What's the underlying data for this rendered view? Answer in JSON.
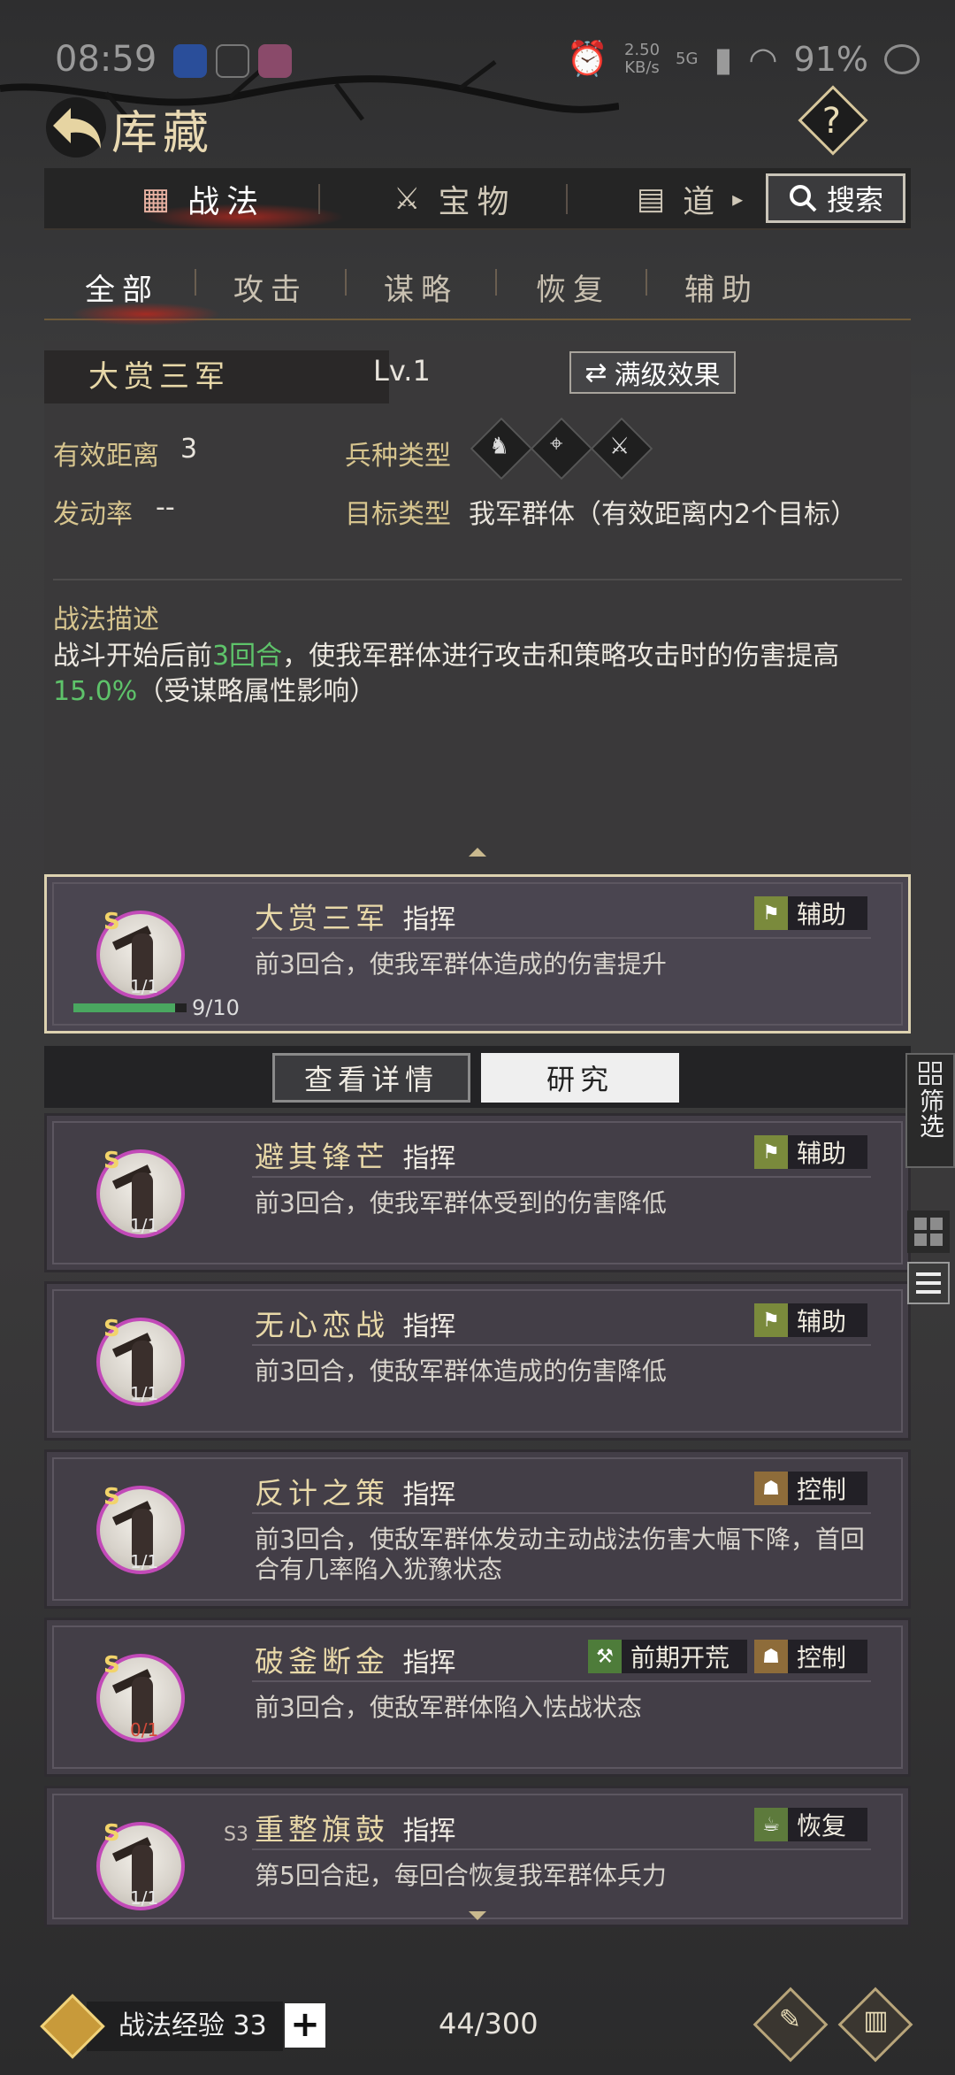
{
  "status": {
    "time": "08:59",
    "net_speed": "2.50\nKB/s",
    "battery": "91%",
    "signal": "5G"
  },
  "header": {
    "title": "库藏",
    "help": "?"
  },
  "tabs": [
    {
      "label": "战法"
    },
    {
      "label": "宝物"
    },
    {
      "label": "道"
    }
  ],
  "search_label": "搜索",
  "subtabs": [
    "全部",
    "攻击",
    "谋略",
    "恢复",
    "辅助"
  ],
  "detail": {
    "name": "大赏三军",
    "level": "Lv.1",
    "max_effect": "满级效果",
    "range_label": "有效距离",
    "range_value": "3",
    "rate_label": "发动率",
    "rate_value": "--",
    "troop_label": "兵种类型",
    "target_label": "目标类型",
    "target_value": "我军群体（有效距离内2个目标）",
    "desc_title": "战法描述",
    "desc_before": "战斗开始后前",
    "desc_g1": "3回合",
    "desc_mid": "，使我军群体进行攻击和策略攻击时的伤害提高",
    "desc_g2": "15.0%",
    "desc_after": "（受谋略属性影响）"
  },
  "cards": [
    {
      "name": "大赏三军",
      "type": "指挥",
      "desc": "前3回合，使我军群体造成的伤害提升",
      "rank": "S",
      "count": "1/1",
      "tag": "辅助",
      "progress_text": "9/10",
      "progress": 0.9
    },
    {
      "name": "避其锋芒",
      "type": "指挥",
      "desc": "前3回合，使我军群体受到的伤害降低",
      "rank": "S",
      "count": "1/1",
      "tag": "辅助"
    },
    {
      "name": "无心恋战",
      "type": "指挥",
      "desc": "前3回合，使敌军群体造成的伤害降低",
      "rank": "S",
      "count": "1/1",
      "tag": "辅助"
    },
    {
      "name": "反计之策",
      "type": "指挥",
      "desc": "前3回合，使敌军群体发动主动战法伤害大幅下降，首回合有几率陷入犹豫状态",
      "rank": "S",
      "count": "1/1",
      "tag": "控制"
    },
    {
      "name": "破釜断金",
      "type": "指挥",
      "desc": "前3回合，使敌军群体陷入怯战状态",
      "rank": "S",
      "count": "0/1",
      "tag": "控制",
      "tag2": "前期开荒"
    },
    {
      "name": "重整旗鼓",
      "type": "指挥",
      "desc": "第5回合起，每回合恢复我军群体兵力",
      "rank": "S",
      "count": "1/1",
      "tag": "恢复",
      "season": "S3"
    }
  ],
  "actions": {
    "detail": "查看详情",
    "research": "研究"
  },
  "filter_label": "筛选",
  "bottom": {
    "exp_label": "战法经验",
    "exp_value": "33",
    "plus": "+",
    "capacity": "44/300"
  }
}
